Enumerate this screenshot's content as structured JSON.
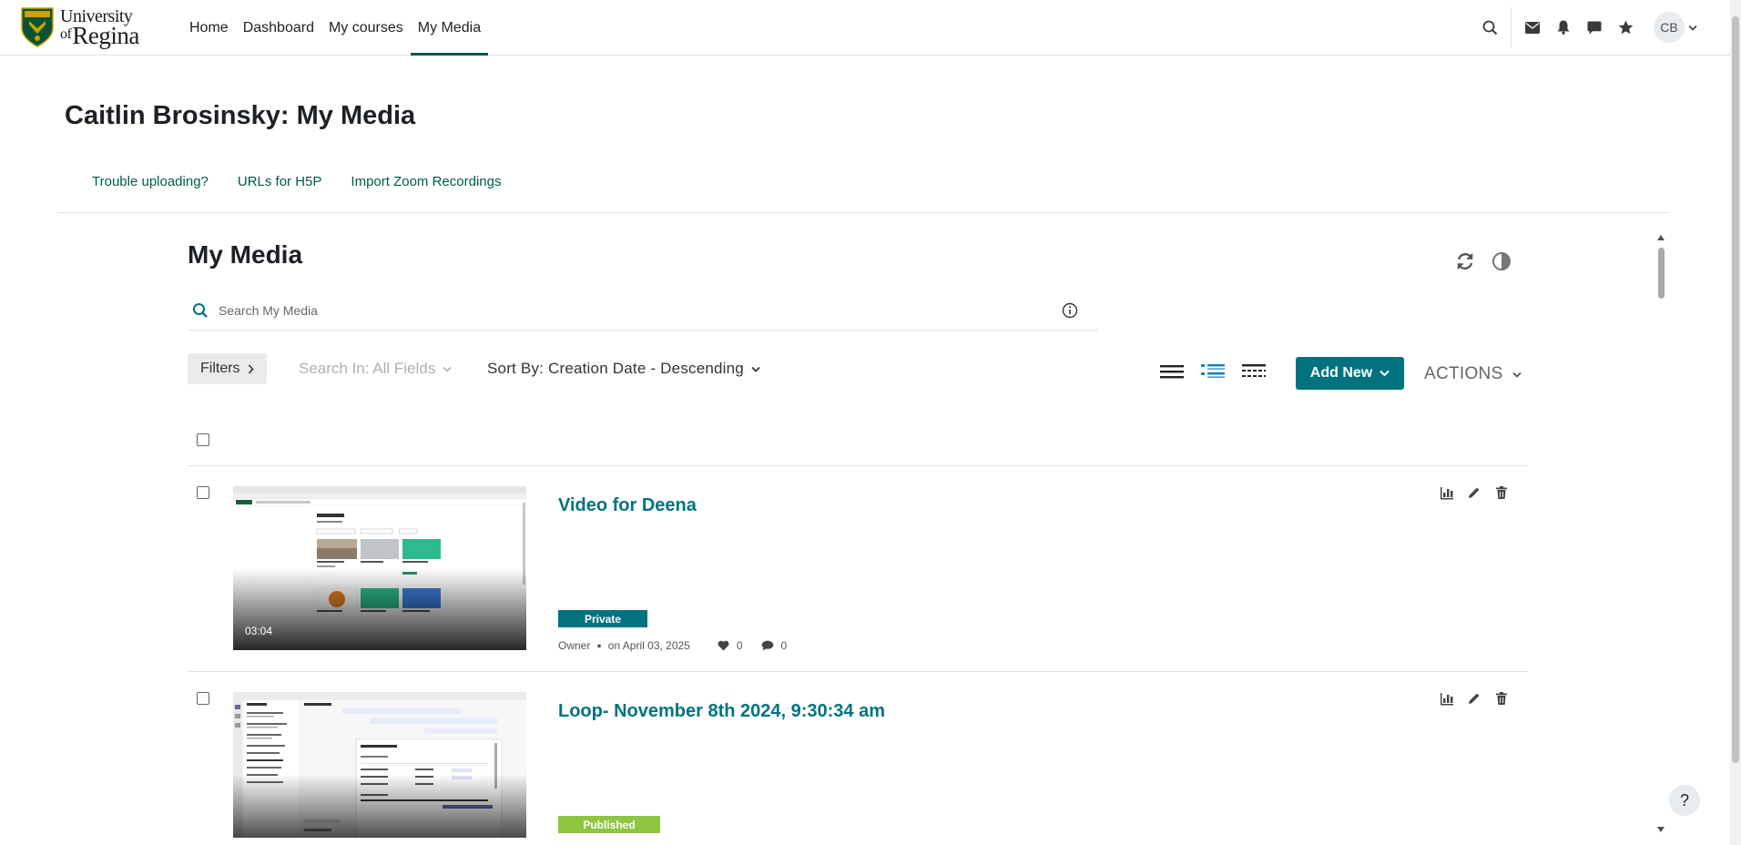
{
  "nav": {
    "logo": {
      "line1": "University",
      "line2_prefix": "of",
      "line2": "Regina"
    },
    "links": [
      "Home",
      "Dashboard",
      "My courses",
      "My Media"
    ],
    "active_link": "My Media",
    "icons": [
      "search-icon",
      "envelope-icon",
      "bell-icon",
      "chat-icon",
      "star-icon"
    ],
    "avatar_initials": "CB"
  },
  "page": {
    "title": "Caitlin Brosinsky: My Media",
    "tabs": [
      "Trouble uploading?",
      "URLs for H5P",
      "Import Zoom Recordings"
    ]
  },
  "media": {
    "heading": "My Media",
    "search_placeholder": "Search My Media",
    "filters_label": "Filters",
    "search_in_label": "Search In: All Fields",
    "sort_label": "Sort By: Creation Date - Descending",
    "add_new_label": "Add New",
    "actions_label": "ACTIONS",
    "entries": [
      {
        "title": "Video for Deena",
        "duration": "03:04",
        "status": "Private",
        "status_color": "#00737f",
        "owner": "Owner",
        "date": "on April 03, 2025",
        "likes": "0",
        "comments": "0"
      },
      {
        "title": "Loop- November 8th 2024, 9:30:34 am",
        "status": "Published",
        "status_color": "#8dc63f"
      }
    ]
  },
  "help_label": "?"
}
